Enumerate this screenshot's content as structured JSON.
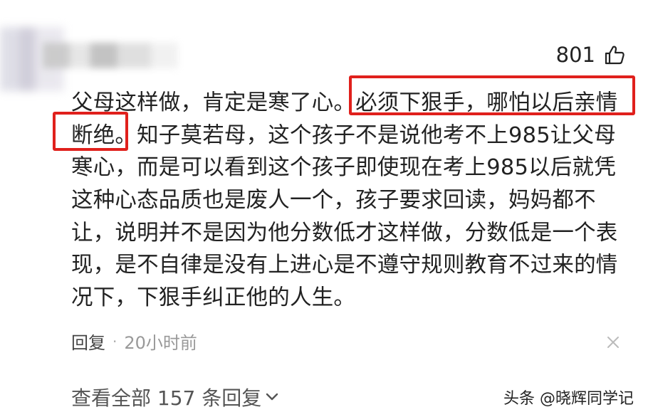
{
  "comment": {
    "like_count": "801",
    "lines": [
      "父母这样做，肯定是寒了心。必须下狠手，哪怕以后亲情",
      "断绝。知子莫若母，这个孩子不是说他考不上985让父母",
      "寒心，而是可以看到这个孩子即使现在考上985以后就凭",
      "这种心态品质也是废人一个，孩子要求回读，妈妈都不",
      "让，说明并不是因为他分数低才这样做，分数低是一个表",
      "现，是不自律是没有上进心是不遵守规则教育不过来的情",
      "况下，下狠手纠正他的人生。"
    ],
    "reply_label": "回复",
    "separator": "·",
    "time": "20小时前",
    "view_all_replies": "查看全部 157 条回复"
  },
  "watermark": "头条 @晓辉同学记",
  "colors": {
    "highlight_border": "#e0201c",
    "text": "#222222",
    "muted": "#999999"
  },
  "icons": [
    "thumbs-up-icon",
    "close-icon",
    "chevron-down-icon"
  ]
}
